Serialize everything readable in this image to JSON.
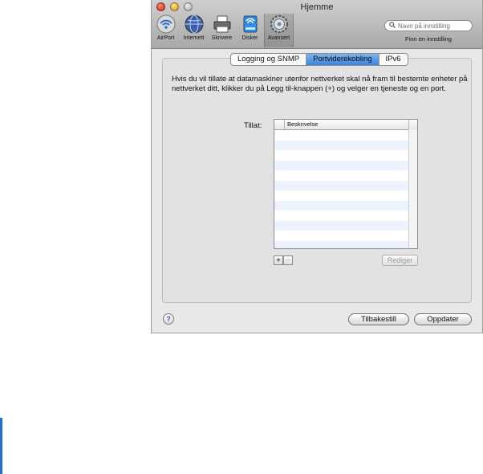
{
  "window": {
    "title": "Hjemme",
    "traffic_lights": [
      "close-icon",
      "minimize-icon",
      "zoom-icon"
    ]
  },
  "toolbar": {
    "items": [
      {
        "label": "AirPort",
        "icon": "airport-icon"
      },
      {
        "label": "Internett",
        "icon": "internet-globe-icon"
      },
      {
        "label": "Skrivere",
        "icon": "printer-icon"
      },
      {
        "label": "Disker",
        "icon": "disk-icon"
      },
      {
        "label": "Avansert",
        "icon": "gear-icon",
        "selected": true
      }
    ],
    "search": {
      "placeholder": "Navn på innstilling",
      "caption": "Finn en innstilling"
    }
  },
  "tabs": [
    {
      "label": "Logging og SNMP",
      "active": false
    },
    {
      "label": "Portviderekobling",
      "active": true
    },
    {
      "label": "IPv6",
      "active": false
    }
  ],
  "content": {
    "description": "Hvis du vil tillate at datamaskiner utenfor nettverket skal nå fram til bestemte enheter på nettverket ditt, klikker du på Legg til-knappen (+) og velger en tjeneste og en port.",
    "allow_label": "Tillat:",
    "list": {
      "column_header": "Beskrivelse",
      "rows": []
    },
    "add_label": "+",
    "remove_label": "−",
    "edit_label": "Rediger"
  },
  "footer": {
    "help_label": "?",
    "reset_label": "Tilbakestill",
    "update_label": "Oppdater"
  },
  "colors": {
    "active_tab": "#3c82dd",
    "row_alt": "#edf3fe"
  }
}
